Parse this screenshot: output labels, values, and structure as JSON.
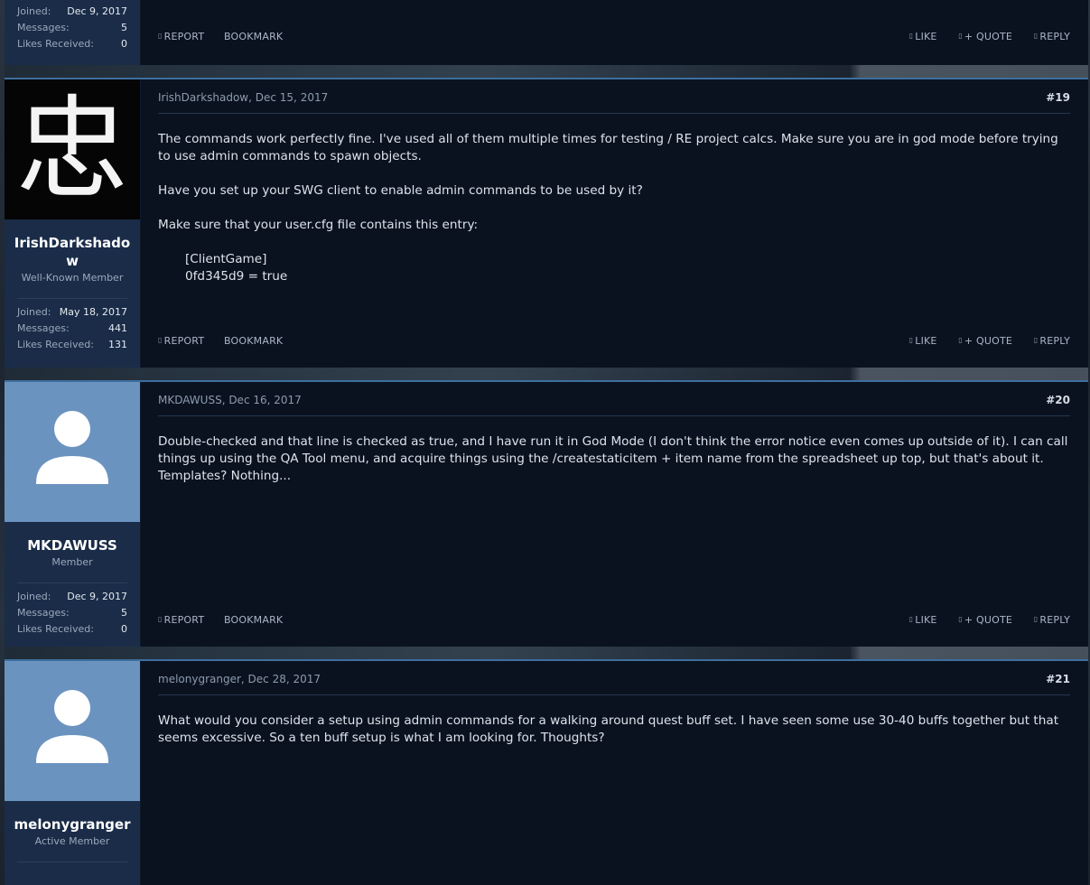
{
  "posts": [
    {
      "user": {
        "joined_label": "Joined:",
        "joined": "Dec 9, 2017",
        "messages_label": "Messages:",
        "messages": "5",
        "likes_label": "Likes Received:",
        "likes": "0"
      },
      "actions": {
        "report": "REPORT",
        "bookmark": "BOOKMARK",
        "like": "LIKE",
        "quote": "+ QUOTE",
        "reply": "REPLY"
      }
    },
    {
      "user": {
        "name": "IrishDarkshadow",
        "title": "Well-Known Member",
        "avatar": "kanji-avatar",
        "avatar_char": "忠",
        "joined_label": "Joined:",
        "joined": "May 18, 2017",
        "messages_label": "Messages:",
        "messages": "441",
        "likes_label": "Likes Received:",
        "likes": "131"
      },
      "meta": {
        "author": "IrishDarkshadow",
        "date": ", Dec 15, 2017",
        "number": "#19"
      },
      "body": {
        "p1": "The commands work perfectly fine. I've used all of them multiple times for testing / RE project calcs. Make sure you are in god mode before trying to use admin commands to spawn objects.",
        "p2": "Have you set up your SWG client to enable admin commands to be used by it?",
        "p3": "Make sure that your user.cfg file contains this entry:",
        "code1": "[ClientGame]",
        "code2": "0fd345d9 = true"
      },
      "actions": {
        "report": "REPORT",
        "bookmark": "BOOKMARK",
        "like": "LIKE",
        "quote": "+ QUOTE",
        "reply": "REPLY"
      }
    },
    {
      "user": {
        "name": "MKDAWUSS",
        "title": "Member",
        "avatar": "default-avatar",
        "joined_label": "Joined:",
        "joined": "Dec 9, 2017",
        "messages_label": "Messages:",
        "messages": "5",
        "likes_label": "Likes Received:",
        "likes": "0"
      },
      "meta": {
        "author": "MKDAWUSS",
        "date": ", Dec 16, 2017",
        "number": "#20"
      },
      "body": {
        "p1": "Double-checked and that line is checked as true, and I have run it in God Mode (I don't think the error notice even comes up outside of it). I can call things up using the QA Tool menu, and acquire things using the /createstaticitem + item name from the spreadsheet up top, but that's about it. Templates? Nothing..."
      },
      "actions": {
        "report": "REPORT",
        "bookmark": "BOOKMARK",
        "like": "LIKE",
        "quote": "+ QUOTE",
        "reply": "REPLY"
      }
    },
    {
      "user": {
        "name": "melonygranger",
        "title": "Active Member",
        "avatar": "default-avatar"
      },
      "meta": {
        "author": "melonygranger",
        "date": ", Dec 28, 2017",
        "number": "#21"
      },
      "body": {
        "p1": "What would you consider a setup using admin commands for a walking around quest buff set. I have seen some use 30-40 buffs together but that seems excessive. So a ten buff setup is what I am looking for. Thoughts?"
      }
    }
  ],
  "icons": {
    "action_icon": "small-square-glyph"
  },
  "colors": {
    "accent": "#3d6f9e",
    "post_bg": "#0a1220",
    "user_bg": "#1a2c48",
    "default_avatar": "#6b93bf"
  }
}
